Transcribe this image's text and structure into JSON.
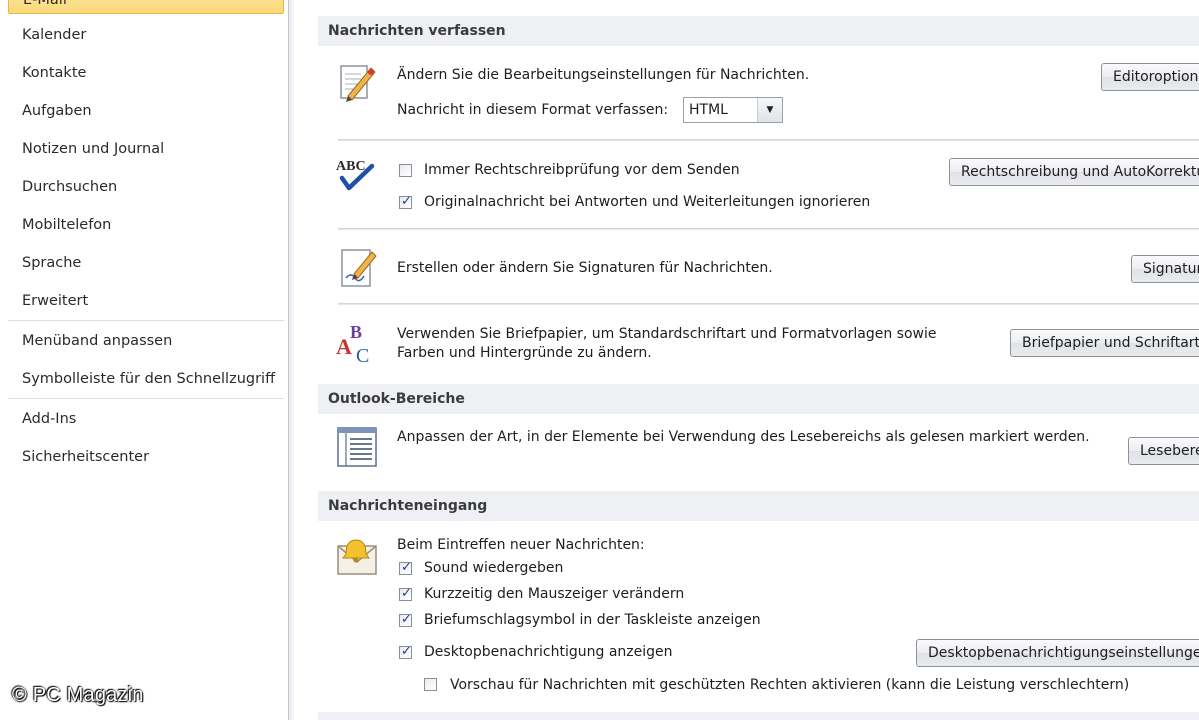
{
  "sidebar": {
    "items": [
      {
        "label": "E-Mail"
      },
      {
        "label": "Kalender"
      },
      {
        "label": "Kontakte"
      },
      {
        "label": "Aufgaben"
      },
      {
        "label": "Notizen und Journal"
      },
      {
        "label": "Durchsuchen"
      },
      {
        "label": "Mobiltelefon"
      },
      {
        "label": "Sprache"
      },
      {
        "label": "Erweitert"
      },
      {
        "label": "Menüband anpassen"
      },
      {
        "label": "Symbolleiste für den Schnellzugriff"
      },
      {
        "label": "Add-Ins"
      },
      {
        "label": "Sicherheitscenter"
      }
    ],
    "selected": "E-Mail"
  },
  "watermark": "© PC Magazin",
  "sections": {
    "compose": {
      "title": "Nachrichten verfassen",
      "editor_text": "Ändern Sie die Bearbeitungseinstellungen für Nachrichten.",
      "editor_button": "Editoroptionen...",
      "format_label": "Nachricht in diesem Format verfassen:",
      "format_value": "HTML",
      "spell_check_label": "Immer Rechtschreibprüfung vor dem Senden",
      "spell_check_checked": false,
      "ignore_original_label": "Originalnachricht bei Antworten und Weiterleitungen ignorieren",
      "ignore_original_checked": true,
      "spelling_button": "Rechtschreibung und AutoKorrektur...",
      "signature_text": "Erstellen oder ändern Sie Signaturen für Nachrichten.",
      "signature_button": "Signaturen...",
      "stationery_text_line1": "Verwenden Sie Briefpapier, um Standardschriftart und Formatvorlagen sowie",
      "stationery_text_line2": "Farben und Hintergründe zu ändern.",
      "stationery_button": "Briefpapier und Schriftarten..."
    },
    "panes": {
      "title": "Outlook-Bereiche",
      "reading_text": "Anpassen der Art, in der Elemente bei Verwendung des Lesebereichs als gelesen markiert werden.",
      "reading_button": "Lesebereich..."
    },
    "arrival": {
      "title": "Nachrichteneingang",
      "intro": "Beim Eintreffen neuer Nachrichten:",
      "options": [
        {
          "label": "Sound wiedergeben",
          "checked": true
        },
        {
          "label": "Kurzzeitig den Mauszeiger verändern",
          "checked": true
        },
        {
          "label": "Briefumschlagsymbol in der Taskleiste anzeigen",
          "checked": true
        },
        {
          "label": "Desktopbenachrichtigung anzeigen",
          "checked": true
        }
      ],
      "preview_label": "Vorschau für Nachrichten mit geschützten Rechten aktivieren (kann die Leistung verschlechtern)",
      "preview_checked": false,
      "desktop_button": "Desktopbenachrichtigungseinstellungen"
    }
  },
  "colors": {
    "selected_bg": "#fbd97a",
    "section_bg": "#eef0f3",
    "check_mark": "#1e3f86"
  }
}
